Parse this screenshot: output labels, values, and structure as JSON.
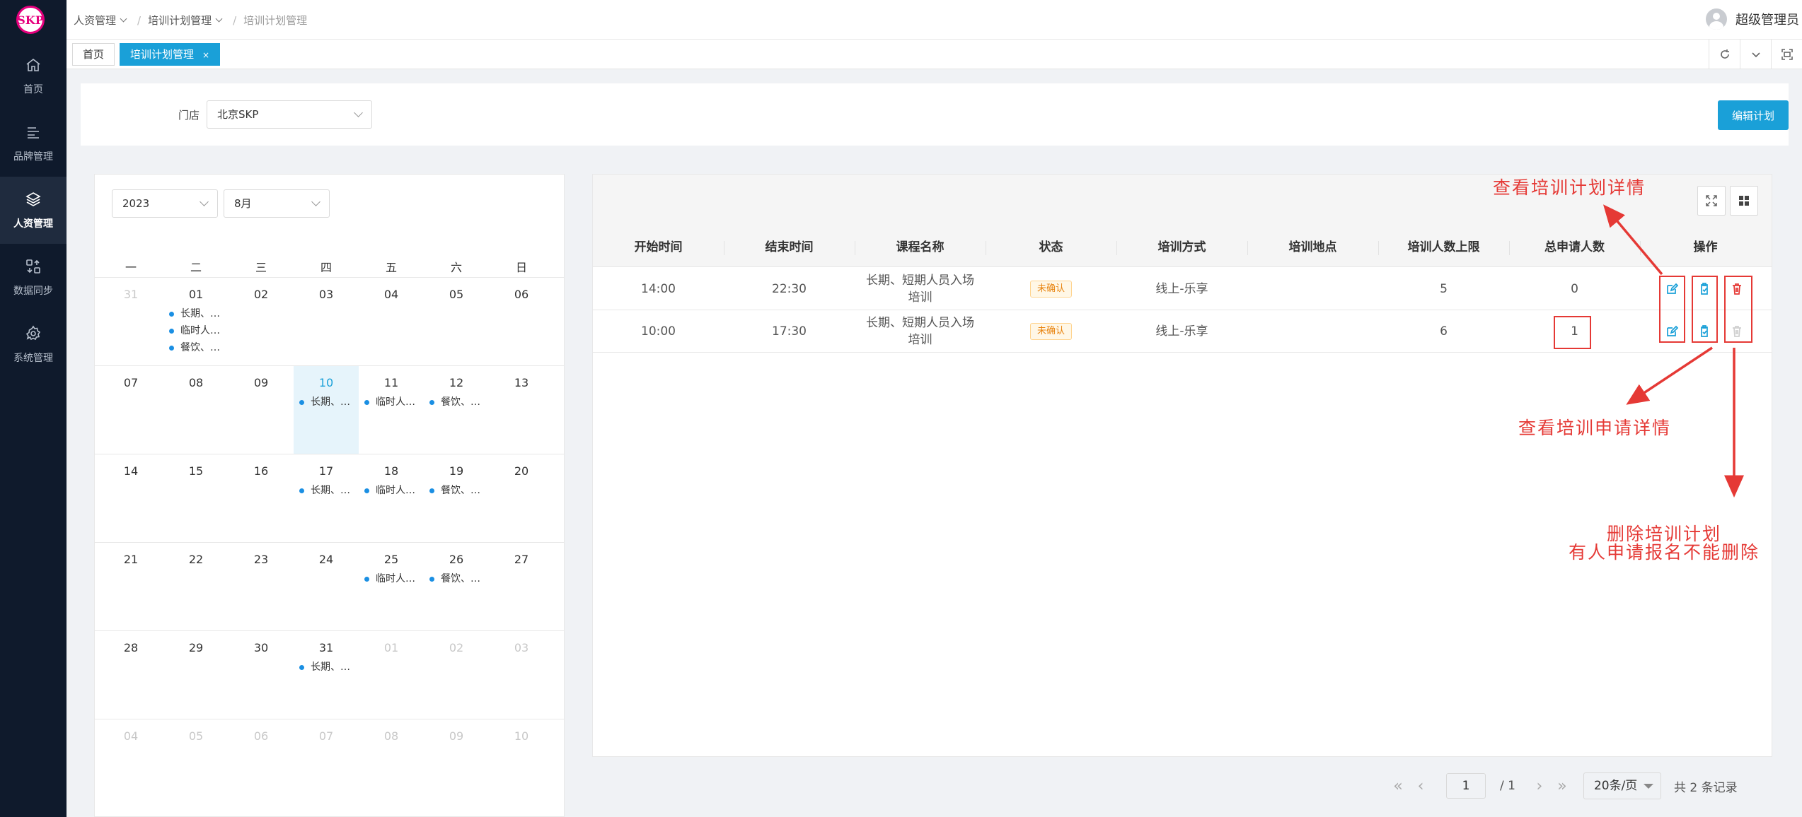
{
  "sidebar": {
    "logo_text": "SKP",
    "items": [
      {
        "label": "首页",
        "icon": "home-icon"
      },
      {
        "label": "品牌管理",
        "icon": "list-icon"
      },
      {
        "label": "人资管理",
        "icon": "layers-icon"
      },
      {
        "label": "数据同步",
        "icon": "sync-icon"
      },
      {
        "label": "系统管理",
        "icon": "gear-icon"
      }
    ],
    "active_index": 2
  },
  "header": {
    "breadcrumb": [
      "人资管理",
      "培训计划管理",
      "培训计划管理"
    ],
    "user_name": "超级管理员"
  },
  "tabs": [
    {
      "label": "首页"
    },
    {
      "label": "培训计划管理",
      "close": "×"
    }
  ],
  "filter": {
    "store_label": "门店",
    "store_value": "北京SKP",
    "edit_button": "编辑计划"
  },
  "calendar": {
    "year": "2023",
    "month": "8月",
    "weekdays": [
      "一",
      "二",
      "三",
      "四",
      "五",
      "六",
      "日"
    ],
    "weeks": [
      [
        {
          "d": "31",
          "muted": true
        },
        {
          "d": "01",
          "events": [
            "长期、…",
            "临时人…",
            "餐饮、…"
          ]
        },
        {
          "d": "02"
        },
        {
          "d": "03"
        },
        {
          "d": "04"
        },
        {
          "d": "05"
        },
        {
          "d": "06"
        }
      ],
      [
        {
          "d": "07"
        },
        {
          "d": "08"
        },
        {
          "d": "09"
        },
        {
          "d": "10",
          "today": true,
          "events": [
            "长期、…"
          ]
        },
        {
          "d": "11",
          "events": [
            "临时人…"
          ]
        },
        {
          "d": "12",
          "events": [
            "餐饮、…"
          ]
        },
        {
          "d": "13"
        }
      ],
      [
        {
          "d": "14"
        },
        {
          "d": "15"
        },
        {
          "d": "16"
        },
        {
          "d": "17",
          "events": [
            "长期、…"
          ]
        },
        {
          "d": "18",
          "events": [
            "临时人…"
          ]
        },
        {
          "d": "19",
          "events": [
            "餐饮、…"
          ]
        },
        {
          "d": "20"
        }
      ],
      [
        {
          "d": "21"
        },
        {
          "d": "22"
        },
        {
          "d": "23"
        },
        {
          "d": "24"
        },
        {
          "d": "25",
          "events": [
            "临时人…"
          ]
        },
        {
          "d": "26",
          "events": [
            "餐饮、…"
          ]
        },
        {
          "d": "27"
        }
      ],
      [
        {
          "d": "28"
        },
        {
          "d": "29"
        },
        {
          "d": "30"
        },
        {
          "d": "31",
          "events": [
            "长期、…"
          ]
        },
        {
          "d": "01",
          "muted": true
        },
        {
          "d": "02",
          "muted": true
        },
        {
          "d": "03",
          "muted": true
        }
      ],
      [
        {
          "d": "04",
          "muted": true
        },
        {
          "d": "05",
          "muted": true
        },
        {
          "d": "06",
          "muted": true
        },
        {
          "d": "07",
          "muted": true
        },
        {
          "d": "08",
          "muted": true
        },
        {
          "d": "09",
          "muted": true
        },
        {
          "d": "10",
          "muted": true
        }
      ]
    ]
  },
  "table": {
    "columns": [
      "开始时间",
      "结束时间",
      "课程名称",
      "状态",
      "培训方式",
      "培训地点",
      "培训人数上限",
      "总申请人数",
      "操作"
    ],
    "rows": [
      {
        "start": "14:00",
        "end": "22:30",
        "course_line1": "长期、短期人员入场",
        "course_line2": "培训",
        "status": "未确认",
        "method": "线上-乐享",
        "location": "",
        "limit": "5",
        "applicants": "0",
        "delete_enabled": true
      },
      {
        "start": "10:00",
        "end": "17:30",
        "course_line1": "长期、短期人员入场",
        "course_line2": "培训",
        "status": "未确认",
        "method": "线上-乐享",
        "location": "",
        "limit": "6",
        "applicants": "1",
        "delete_enabled": false
      }
    ]
  },
  "pagination": {
    "current": "1",
    "total_pages": "/ 1",
    "page_size": "20条/页",
    "total": "共 2 条记录"
  },
  "annotations": {
    "plan_detail": "查看培训计划详情",
    "apply_detail": "查看培训申请详情",
    "delete_line1": "删除培训计划",
    "delete_line2": "有人申请报名不能删除"
  },
  "colors": {
    "primary": "#1aa0d8",
    "sidebar_bg": "#0f1a2c",
    "annotation": "#e53935",
    "status": "#e8820c",
    "delete_icon": "#e53935"
  }
}
